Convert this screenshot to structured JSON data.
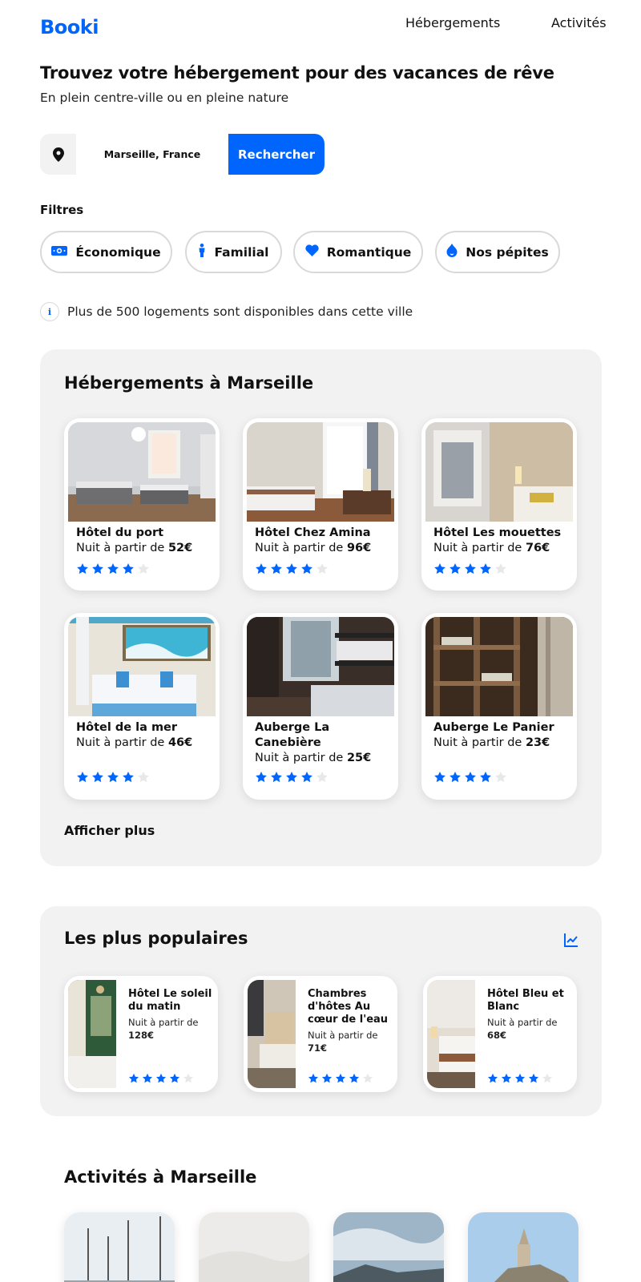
{
  "header": {
    "logo": "Booki",
    "nav": [
      "Hébergements",
      "Activités"
    ]
  },
  "hero": {
    "title": "Trouvez votre hébergement pour des vacances de rêve",
    "subtitle": "En plein centre-ville ou en pleine nature"
  },
  "search": {
    "value": "Marseille, France",
    "button_label": "Rechercher",
    "icon": "location-pin-icon"
  },
  "filters": {
    "label": "Filtres",
    "items": [
      {
        "label": "Économique",
        "icon": "money-icon"
      },
      {
        "label": "Familial",
        "icon": "person-icon"
      },
      {
        "label": "Romantique",
        "icon": "heart-icon"
      },
      {
        "label": "Nos pépites",
        "icon": "fire-icon"
      }
    ]
  },
  "info": {
    "icon_text": "i",
    "text": "Plus de 500 logements sont disponibles dans cette ville"
  },
  "hebergements": {
    "title": "Hébergements à Marseille",
    "cards": [
      {
        "name": "Hôtel du port",
        "price_prefix": "Nuit à partir de ",
        "price": "52€",
        "rating": 4
      },
      {
        "name": "Hôtel Chez Amina",
        "price_prefix": "Nuit à partir de ",
        "price": "96€",
        "rating": 4
      },
      {
        "name": "Hôtel Les mouettes",
        "price_prefix": "Nuit à partir de ",
        "price": "76€",
        "rating": 4
      },
      {
        "name": "Hôtel de la mer",
        "price_prefix": "Nuit à partir de ",
        "price": "46€",
        "rating": 4
      },
      {
        "name": "Auberge La Canebière",
        "price_prefix": "Nuit à partir de ",
        "price": "25€",
        "rating": 4
      },
      {
        "name": "Auberge Le Panier",
        "price_prefix": "Nuit à partir de ",
        "price": "23€",
        "rating": 4
      }
    ],
    "more_label": "Afficher plus"
  },
  "populaires": {
    "title": "Les plus populaires",
    "icon": "trend-chart-icon",
    "cards": [
      {
        "name": "Hôtel Le soleil du matin",
        "price_prefix": "Nuit à partir de ",
        "price": "128€",
        "rating": 4
      },
      {
        "name": "Chambres d'hôtes Au cœur de l'eau",
        "price_prefix": "Nuit à partir de ",
        "price": "71€",
        "rating": 4
      },
      {
        "name": "Hôtel Bleu et Blanc",
        "price_prefix": "Nuit à partir de ",
        "price": "68€",
        "rating": 4
      }
    ]
  },
  "activites": {
    "title": "Activités à Marseille"
  },
  "colors": {
    "accent": "#0065FC",
    "panel": "#F2F2F2",
    "star_empty": "#E8E8E8"
  }
}
